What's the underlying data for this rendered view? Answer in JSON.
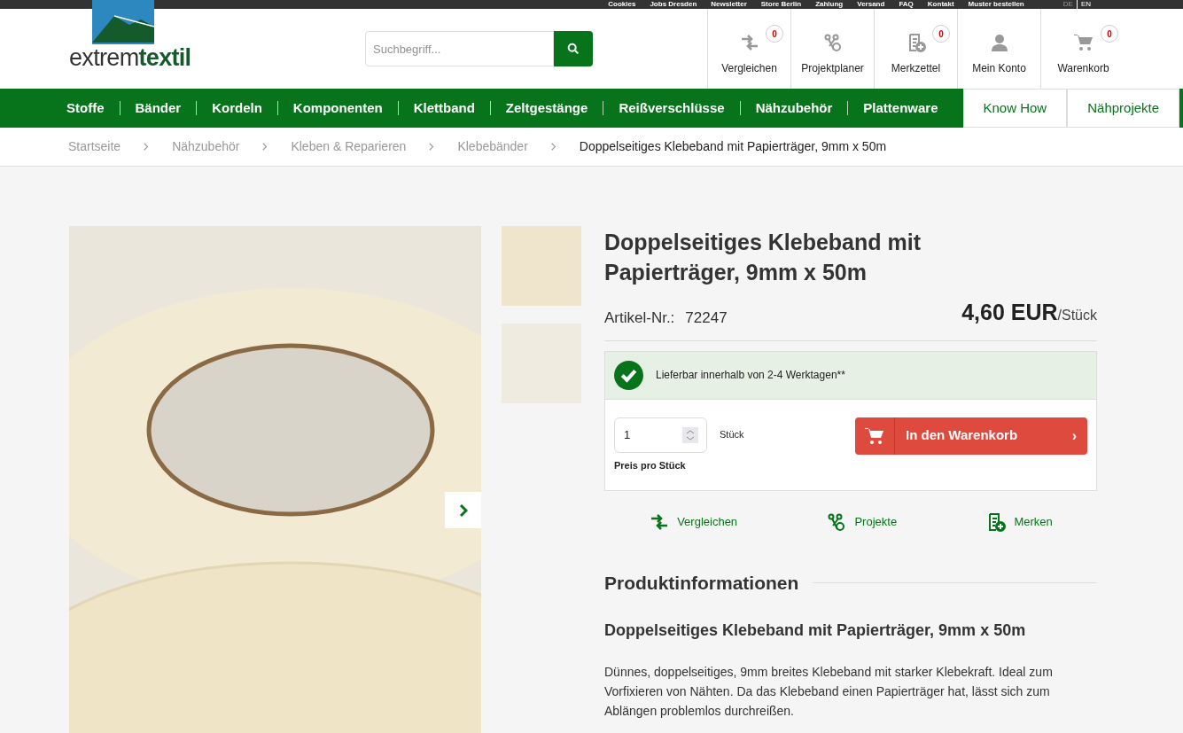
{
  "top_links": [
    "Cookies",
    "Jobs Dresden",
    "Newsletter",
    "Store Berlin",
    "Zahlung",
    "Versand",
    "FAQ",
    "Kontakt",
    "Muster bestellen"
  ],
  "languages": [
    {
      "label": "DE",
      "selected": true
    },
    {
      "label": "EN",
      "selected": false
    }
  ],
  "logo": {
    "light": "extrem",
    "bold": "textil"
  },
  "search": {
    "placeholder": "Suchbegriff..."
  },
  "header_actions": [
    {
      "kind": "compare",
      "label": "Vergleichen",
      "count": "0"
    },
    {
      "kind": "scissors",
      "label": "Projektplaner"
    },
    {
      "kind": "notepad",
      "label": "Merkzettel",
      "count": "0"
    },
    {
      "kind": "person",
      "label": "Mein Konto"
    },
    {
      "kind": "cart",
      "label": "Warenkorb",
      "count": "0"
    }
  ],
  "nav": [
    {
      "label": "Stoffe",
      "kind": "main"
    },
    {
      "label": "Bänder",
      "kind": "main"
    },
    {
      "label": "Kordeln",
      "kind": "main"
    },
    {
      "label": "Komponenten",
      "kind": "main"
    },
    {
      "label": "Klettband",
      "kind": "main"
    },
    {
      "label": "Zeltgestänge",
      "kind": "main"
    },
    {
      "label": "Reißverschlüsse",
      "kind": "main"
    },
    {
      "label": "Nähzubehör",
      "kind": "main"
    },
    {
      "label": "Plattenware",
      "kind": "main"
    },
    {
      "label": "Know How",
      "kind": "tab"
    },
    {
      "label": "Nähprojekte",
      "kind": "tab"
    }
  ],
  "breadcrumb": [
    "Startseite",
    "Nähzubehör",
    "Kleben & Reparieren",
    "Klebebänder",
    "Doppelseitiges Klebeband mit Papierträger, 9mm x 50m"
  ],
  "product": {
    "title": "Doppelseitiges Klebeband mit Papierträger, 9mm x 50m",
    "article_label": "Artikel-Nr.:",
    "article_number": "72247",
    "price": "4,60 EUR",
    "unit": "/Stück",
    "availability": "Lieferbar innerhalb von 2-4 Werktagen**",
    "quantity": "1",
    "quantity_unit": "Stück",
    "price_note": "Preis pro Stück",
    "cart_button": "In den Warenkorb",
    "cart_chevron": "›",
    "actions": [
      {
        "kind": "compare",
        "label": "Vergleichen"
      },
      {
        "kind": "scissors",
        "label": "Projekte"
      },
      {
        "kind": "notepad",
        "label": "Merken"
      }
    ],
    "info_heading": "Produktinformationen",
    "info_title": "Doppelseitiges Klebeband mit Papierträger, 9mm x 50m",
    "description": "Dünnes, doppelseitiges, 9mm breites Klebeband mit starker Klebekraft. Ideal zum Vorfixieren von Nähten. Da das Klebeband einen Papierträger hat, lässt sich zum Ablängen problemlos durchreißen."
  }
}
